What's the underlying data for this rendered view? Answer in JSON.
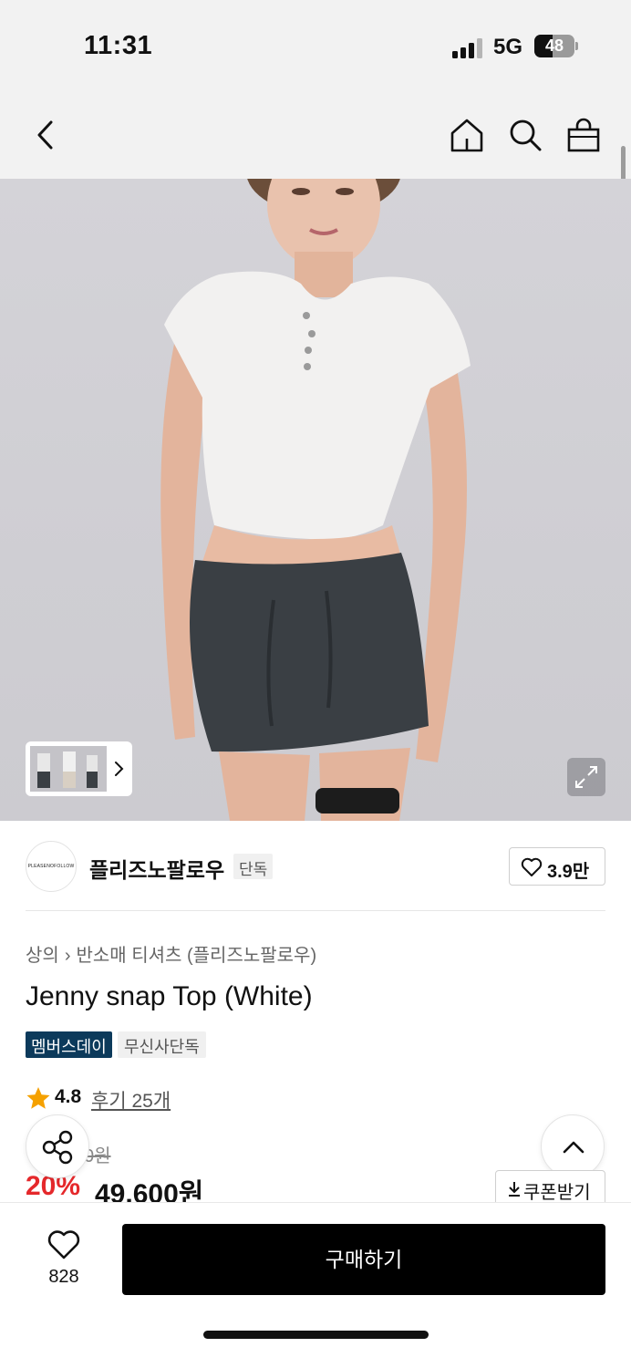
{
  "status_bar": {
    "time": "11:31",
    "network": "5G",
    "battery": "48"
  },
  "brand": {
    "logo_text": "PLEASENOFOLLOW",
    "name": "플리즈노팔로우",
    "badge": "단독",
    "like_count": "3.9만"
  },
  "breadcrumb": {
    "category": "상의",
    "subcategory": "반소매 티셔츠 (플리즈노팔로우)"
  },
  "product": {
    "title": "Jenny snap Top (White)",
    "tags": [
      "멤버스데이",
      "무신사단독"
    ],
    "rating": "4.8",
    "review_label": "후기 25개",
    "original_price_visible": "0원",
    "discount": "20%",
    "sale_price": "49,600원"
  },
  "actions": {
    "coupon_label": "쿠폰받기",
    "buy_label": "구매하기",
    "wish_count": "828"
  },
  "colors": {
    "accent_red": "#e5282b",
    "member_tag_bg": "#0c3a5b",
    "buy_bg": "#000000"
  }
}
